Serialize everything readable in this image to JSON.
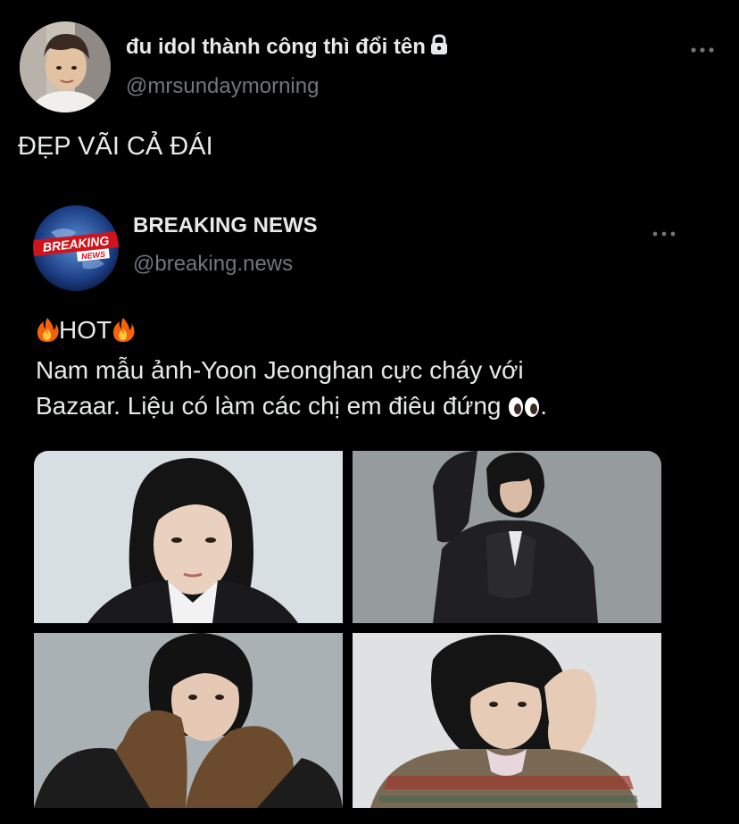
{
  "author": {
    "display_name": "đu idol thành công thì đổi tên",
    "handle": "@mrsundaymorning",
    "protected_icon": "lock-icon",
    "avatar_icon": "profile-photo"
  },
  "tweet": {
    "text": "ĐẸP VÃI CẢ ĐÁI"
  },
  "quoted": {
    "display_name": "BREAKING NEWS",
    "handle": "@breaking.news",
    "avatar_logo_text_1": "BREAKING",
    "avatar_logo_text_2": "NEWS",
    "hot_label": "HOT",
    "line_2": "Nam mẫu ảnh-Yoon Jeonghan cực cháy với",
    "line_3": "Bazaar. Liệu có làm các chị em điêu đứng",
    "line_3_end": ".",
    "emoji_fire": "fire-emoji",
    "emoji_eyes": "eyes-emoji"
  },
  "media": {
    "photo_count": 4,
    "photos": [
      "photo-1",
      "photo-2",
      "photo-3",
      "photo-4"
    ]
  },
  "colors": {
    "background": "#000000",
    "primary_text": "#e7e9ea",
    "secondary_text": "#71767b"
  }
}
